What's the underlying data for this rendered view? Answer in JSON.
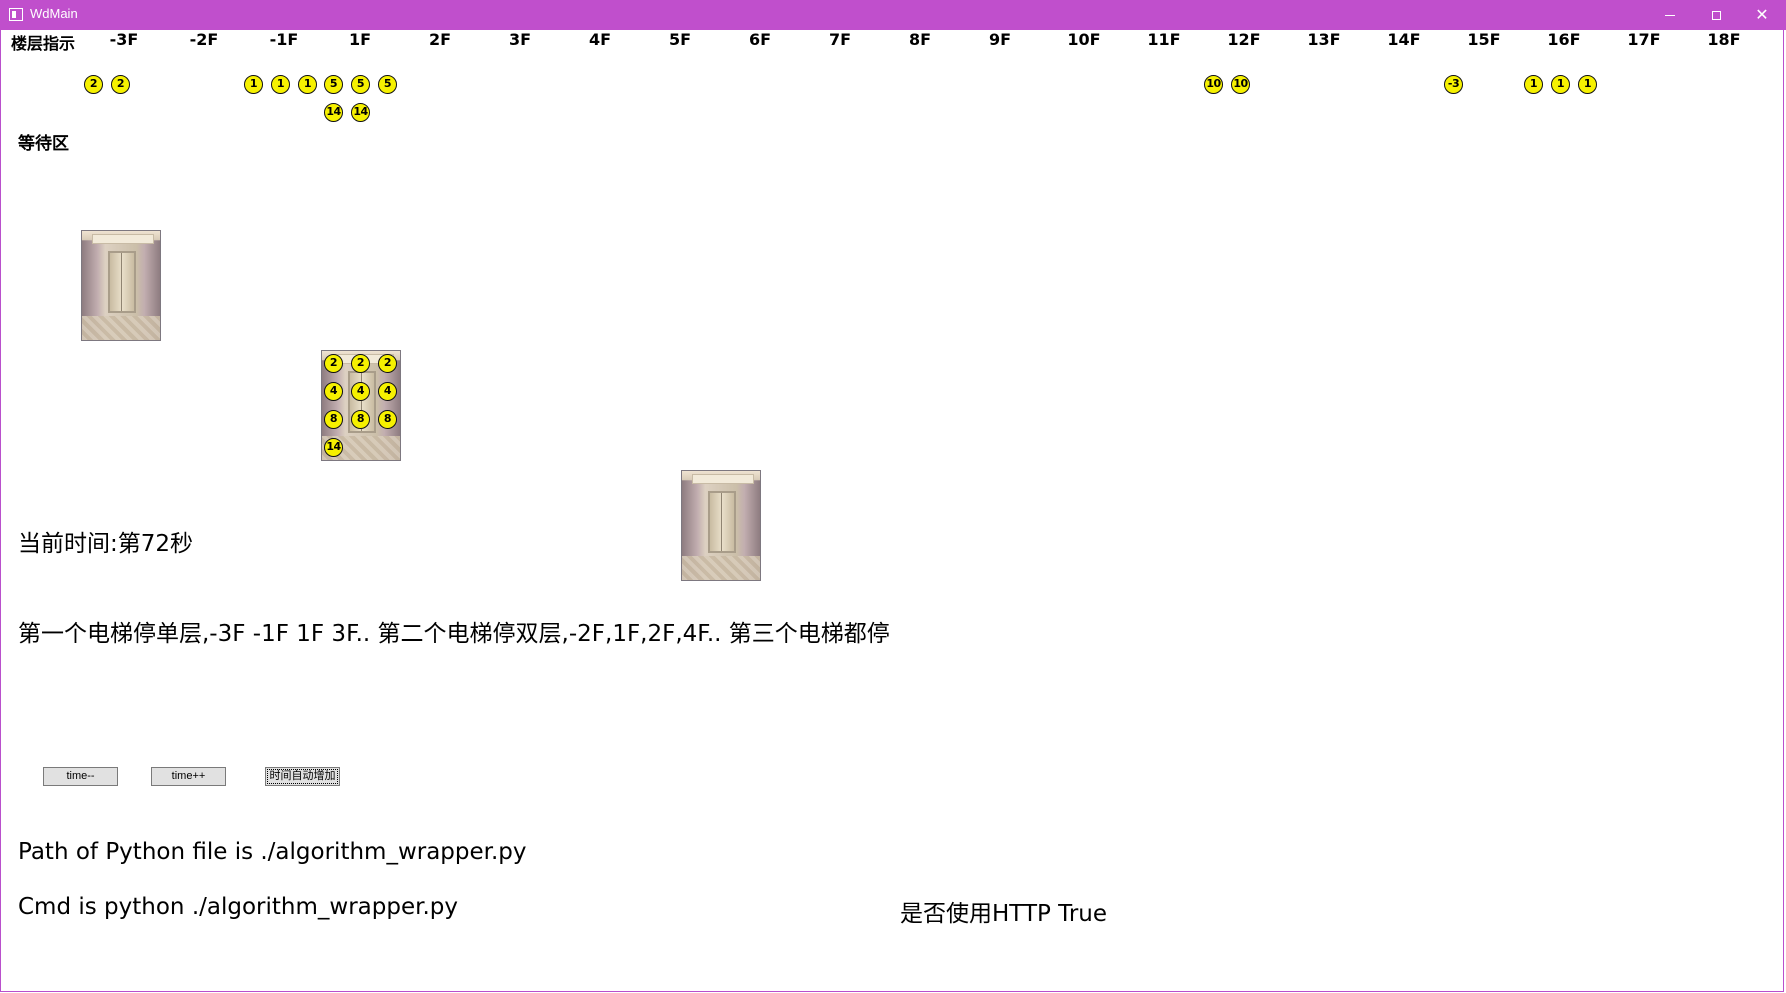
{
  "window": {
    "title": "WdMain",
    "controls": [
      "minimize-icon",
      "maximize-icon",
      "close-icon"
    ],
    "accent_color": "#c04fcc"
  },
  "floor_indicator": {
    "title": "楼层指示",
    "floors": [
      "-3F",
      "-2F",
      "-1F",
      "1F",
      "2F",
      "3F",
      "4F",
      "5F",
      "6F",
      "7F",
      "8F",
      "9F",
      "10F",
      "11F",
      "12F",
      "13F",
      "14F",
      "15F",
      "16F",
      "17F",
      "18F"
    ]
  },
  "waiting_passengers": {
    "-3F": [
      "2",
      "2"
    ],
    "-1F": [
      "1",
      "1",
      "1"
    ],
    "1F": [
      "5",
      "5",
      "5",
      "14",
      "14"
    ],
    "12F": [
      "10",
      "10"
    ],
    "15F": [
      "-3"
    ],
    "16F": [
      "1",
      "1",
      "1"
    ]
  },
  "waiting_area": {
    "title": "等待区"
  },
  "elevators": [
    {
      "floor": "-3F",
      "passengers": []
    },
    {
      "floor": "1F",
      "passengers": [
        "2",
        "2",
        "2",
        "4",
        "4",
        "4",
        "8",
        "8",
        "8",
        "14"
      ]
    },
    {
      "floor": "5F",
      "passengers": []
    }
  ],
  "status": {
    "current_time": "当前时间:第72秒",
    "description": "第一个电梯停单层,-3F -1F 1F 3F.. 第二个电梯停双层,-2F,1F,2F,4F.. 第三个电梯都停"
  },
  "controls": {
    "time_dec": "time--",
    "time_inc": "time++",
    "auto_time": "时间自动增加"
  },
  "info": {
    "python_path": "Path of Python file is ./algorithm_wrapper.py",
    "cmd": "Cmd is python ./algorithm_wrapper.py",
    "use_http": "是否使用HTTP True"
  },
  "colors": {
    "badge_fill": "#f6f100",
    "titlebar": "#c04fcc"
  }
}
